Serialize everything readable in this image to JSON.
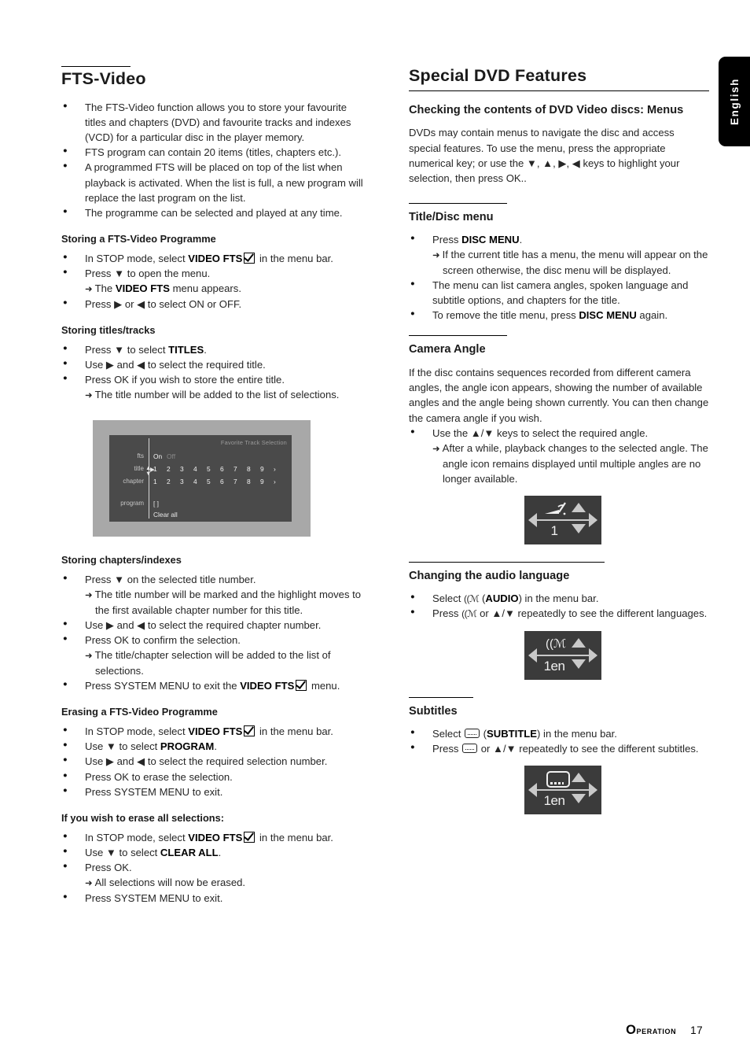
{
  "lang_tab": {
    "label": "English"
  },
  "footer": {
    "section": "peration",
    "section_cap": "O",
    "page": "17"
  },
  "left": {
    "h1": "FTS-Video",
    "intro_bullets": [
      "The FTS-Video function allows you to store your favourite titles and chapters (DVD) and favourite tracks and indexes (VCD) for a particular disc in the player memory.",
      "FTS program can contain 20 items (titles, chapters etc.).",
      "A programmed FTS will be placed on top of the list when playback is activated. When the list is full, a new program will replace the last program on the list.",
      "The programme can be selected and played at any time."
    ],
    "storing_programme": {
      "heading": "Storing a FTS-Video Programme",
      "b1_pre": "In STOP mode, select ",
      "b1_bold": "VIDEO FTS",
      "b1_post": " in the menu bar.",
      "b2": "Press ▼ to open the menu.",
      "b2_arrow_pre": "The ",
      "b2_arrow_bold": "VIDEO FTS",
      "b2_arrow_post": " menu appears.",
      "b3": "Press ▶ or ◀  to select ON or OFF."
    },
    "storing_titles": {
      "heading": "Storing titles/tracks",
      "b1_pre": "Press ▼ to select ",
      "b1_bold": "TITLES",
      "b1_post": ".",
      "b2": "Use ▶ and ◀ to select the required title.",
      "b3": "Press OK if you wish to store the entire title.",
      "b3_arrow": "The title number will be added to the list of selections."
    },
    "fts_screen": {
      "title": "Favorite Track Selection",
      "rows": [
        {
          "label": "fts",
          "values": [
            "On",
            "Off"
          ],
          "dim_from": 1
        },
        {
          "label": "title",
          "values": [
            "1",
            "2",
            "3",
            "4",
            "5",
            "6",
            "7",
            "8",
            "9",
            "›"
          ],
          "selector": true
        },
        {
          "label": "chapter",
          "values": [
            "1",
            "2",
            "3",
            "4",
            "5",
            "6",
            "7",
            "8",
            "9",
            "›"
          ]
        },
        {
          "label": "program",
          "values": [
            "[ ]"
          ]
        },
        {
          "label": "",
          "values": [
            "Clear all"
          ]
        }
      ]
    },
    "storing_chapters": {
      "heading": "Storing chapters/indexes",
      "b1": "Press ▼ on the selected title number.",
      "b1_arrow": "The title number will be marked and the highlight moves to the first available chapter number for this title.",
      "b2": "Use ▶ and ◀ to select the required chapter number.",
      "b3": "Press OK to confirm the selection.",
      "b3_arrow": "The title/chapter selection will be added to the list of selections.",
      "b4_pre": "Press SYSTEM MENU to exit the ",
      "b4_bold": "VIDEO FTS",
      "b4_post": " menu."
    },
    "erasing": {
      "heading": "Erasing a FTS-Video Programme",
      "b1_pre": "In STOP mode, select ",
      "b1_bold": "VIDEO FTS",
      "b1_post": " in the menu bar.",
      "b2_pre": "Use ▼ to select ",
      "b2_bold": "PROGRAM",
      "b2_post": ".",
      "b3": "Use ▶ and ◀ to select the required selection number.",
      "b4": "Press OK to erase the selection.",
      "b5": "Press SYSTEM MENU to exit."
    },
    "erase_all": {
      "heading": "If you wish to erase all selections:",
      "b1_pre": "In STOP mode, select ",
      "b1_bold": "VIDEO FTS",
      "b1_post": " in the menu bar.",
      "b2_pre": "Use ▼ to select ",
      "b2_bold": "CLEAR ALL",
      "b2_post": ".",
      "b3": "Press OK.",
      "b3_arrow": "All selections will now be erased.",
      "b4": "Press SYSTEM MENU to exit."
    }
  },
  "right": {
    "h1": "Special DVD Features",
    "checking": {
      "heading": "Checking the contents of DVD Video discs: Menus",
      "para": "DVDs may contain menus to navigate the disc and access special features. To use the menu, press the appropriate numerical key; or use the ▼, ▲, ▶, ◀ keys to highlight your selection, then press OK.."
    },
    "title_disc": {
      "heading": "Title/Disc menu",
      "b1_pre": "Press ",
      "b1_bold": "DISC MENU",
      "b1_post": ".",
      "b1_arrow": "If the current title has a menu, the menu will appear on the screen otherwise, the disc menu will be displayed.",
      "b2": "The menu can list camera angles, spoken language and subtitle options, and chapters for the title.",
      "b3_pre": "To remove the title menu, press ",
      "b3_bold": "DISC MENU",
      "b3_post": " again."
    },
    "camera_angle": {
      "heading": "Camera Angle",
      "para": "If the disc contains sequences recorded from different camera angles, the angle icon appears, showing the number of available angles and the angle being shown currently. You can then change the camera angle if you wish.",
      "b1": "Use the ▲/▼ keys to select the required angle.",
      "b1_arrow": "After a while, playback changes to the selected angle. The angle  icon remains displayed until multiple angles are no longer available.",
      "osd_value": "1"
    },
    "audio_language": {
      "heading": "Changing the audio language",
      "b1_pre": "Select ",
      "b1_icon": "audio-icon",
      "b1_mid": " (",
      "b1_bold": "AUDIO",
      "b1_post": ") in the menu bar.",
      "b2_pre": "Press ",
      "b2_post": " or ▲/▼ repeatedly to see the different languages.",
      "osd_value": "1en"
    },
    "subtitles": {
      "heading": "Subtitles",
      "b1_pre": "Select ",
      "b1_mid": " (",
      "b1_bold": "SUBTITLE",
      "b1_post": ") in the menu bar.",
      "b2_pre": "Press ",
      "b2_post": " or ▲/▼ repeatedly to see the different subtitles.",
      "osd_value": "1en"
    }
  }
}
